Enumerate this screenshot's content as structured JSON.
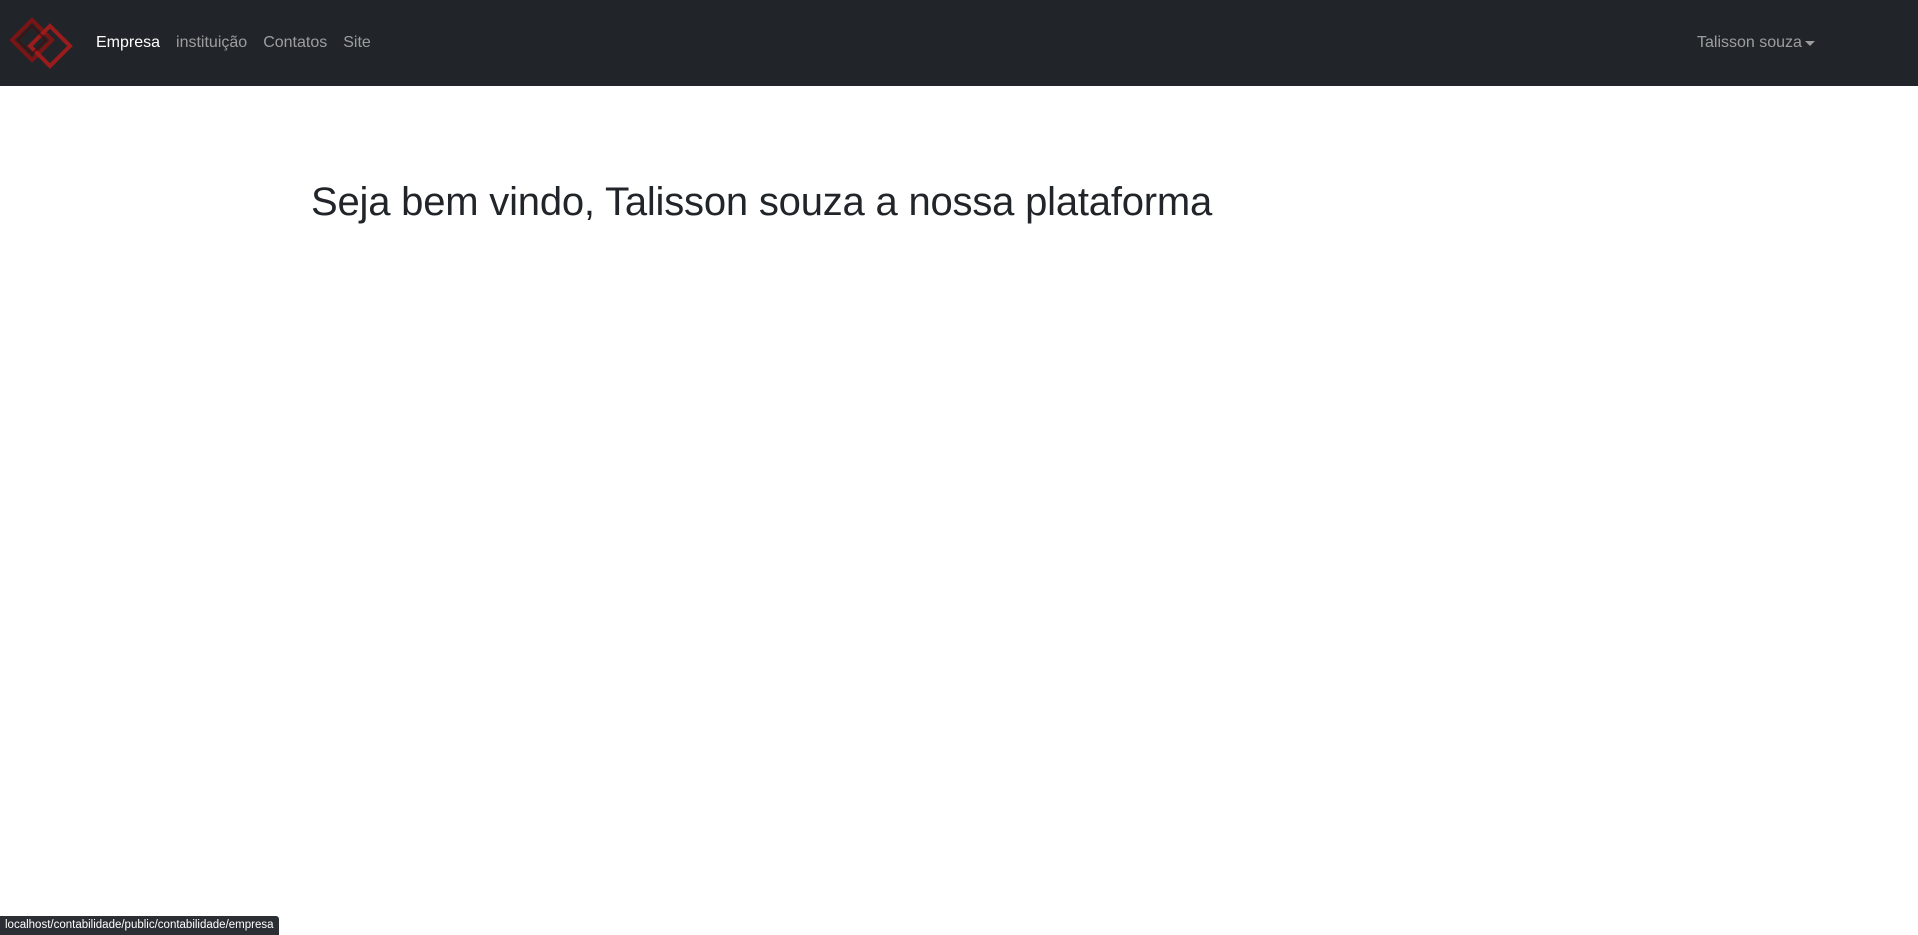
{
  "navbar": {
    "brand_icon": "diamond-logo-icon",
    "brand_color": "#8b1a1a",
    "items": [
      {
        "label": "Empresa",
        "active": true
      },
      {
        "label": "instituição",
        "active": false
      },
      {
        "label": "Contatos",
        "active": false
      },
      {
        "label": "Site",
        "active": false
      }
    ],
    "user_menu": {
      "label": "Talisson souza",
      "icon": "caret-down-icon"
    }
  },
  "main": {
    "heading": "Seja bem vindo, Talisson souza a nossa plataforma"
  },
  "status_bar": {
    "url": "localhost/contabilidade/public/contabilidade/empresa"
  }
}
